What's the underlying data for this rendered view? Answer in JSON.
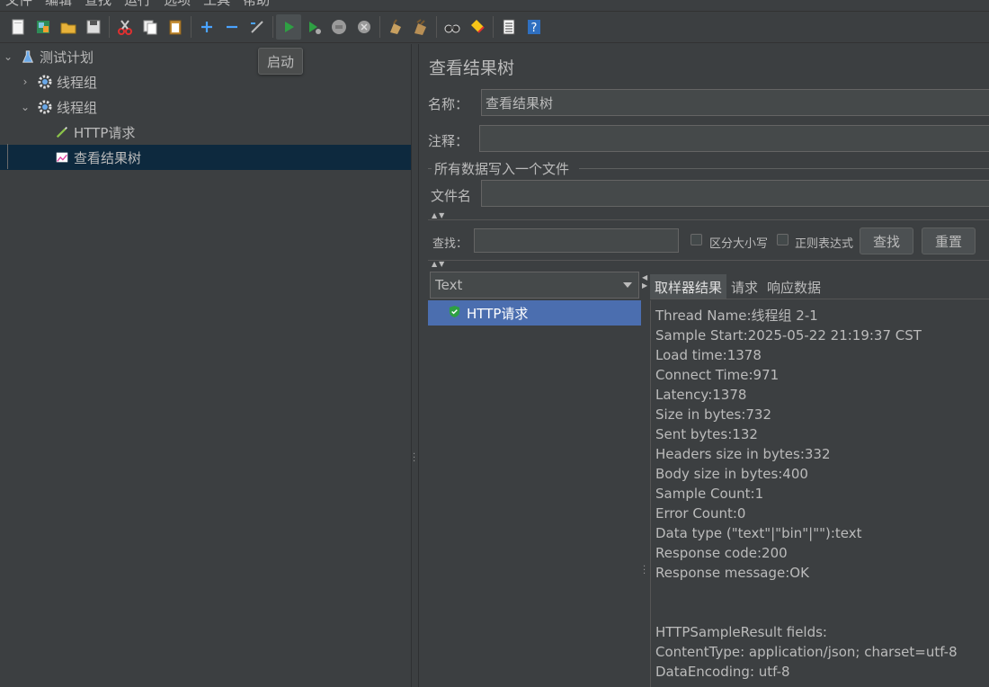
{
  "menu": [
    "文件",
    "编辑",
    "查找",
    "运行",
    "选项",
    "工具",
    "帮助"
  ],
  "toolbar": {
    "tooltip": "启动",
    "buttons": [
      "new-icon",
      "templates-icon",
      "open-icon",
      "save-icon",
      "cut-icon",
      "copy-icon",
      "paste-icon",
      "expand-icon",
      "collapse-icon",
      "toggle-icon",
      "start-icon",
      "start-no-pause-icon",
      "stop-icon",
      "shutdown-icon",
      "clear-icon",
      "clear-all-icon",
      "search-icon",
      "reset-search-icon",
      "function-helper-icon",
      "help-icon"
    ]
  },
  "tree": {
    "root": "测试计划",
    "thread_group_1": "线程组",
    "thread_group_2": "线程组",
    "http_request": "HTTP请求",
    "listener": "查看结果树"
  },
  "panel": {
    "title": "查看结果树",
    "name_label": "名称：",
    "name_value": "查看结果树",
    "comment_label": "注释：",
    "comment_value": "",
    "file_group_title": "所有数据写入一个文件",
    "filename_label": "文件名",
    "filename_value": ""
  },
  "search": {
    "label": "查找：",
    "value": "",
    "case_sensitive_label": "区分大小写",
    "regex_label": "正则表达式",
    "find_button": "查找",
    "reset_button": "重置"
  },
  "results": {
    "renderer": "Text",
    "items": [
      "HTTP请求"
    ],
    "tabs": [
      "取样器结果",
      "请求",
      "响应数据"
    ],
    "active_tab": "取样器结果",
    "lines": [
      "Thread Name:线程组 2-1",
      "Sample Start:2025-05-22 21:19:37 CST",
      "Load time:1378",
      "Connect Time:971",
      "Latency:1378",
      "Size in bytes:732",
      "Sent bytes:132",
      "Headers size in bytes:332",
      "Body size in bytes:400",
      "Sample Count:1",
      "Error Count:0",
      "Data type (\"text\"|\"bin\"|\"\"):text",
      "Response code:200",
      "Response message:OK",
      "",
      "",
      "HTTPSampleResult fields:",
      "ContentType: application/json; charset=utf-8",
      "DataEncoding: utf-8"
    ]
  },
  "colors": {
    "background": "#3c3f41",
    "selection_tree": "#0d293e",
    "selection_list": "#4b6eaf",
    "field_bg": "#45494a",
    "success_green": "#2ea043"
  }
}
